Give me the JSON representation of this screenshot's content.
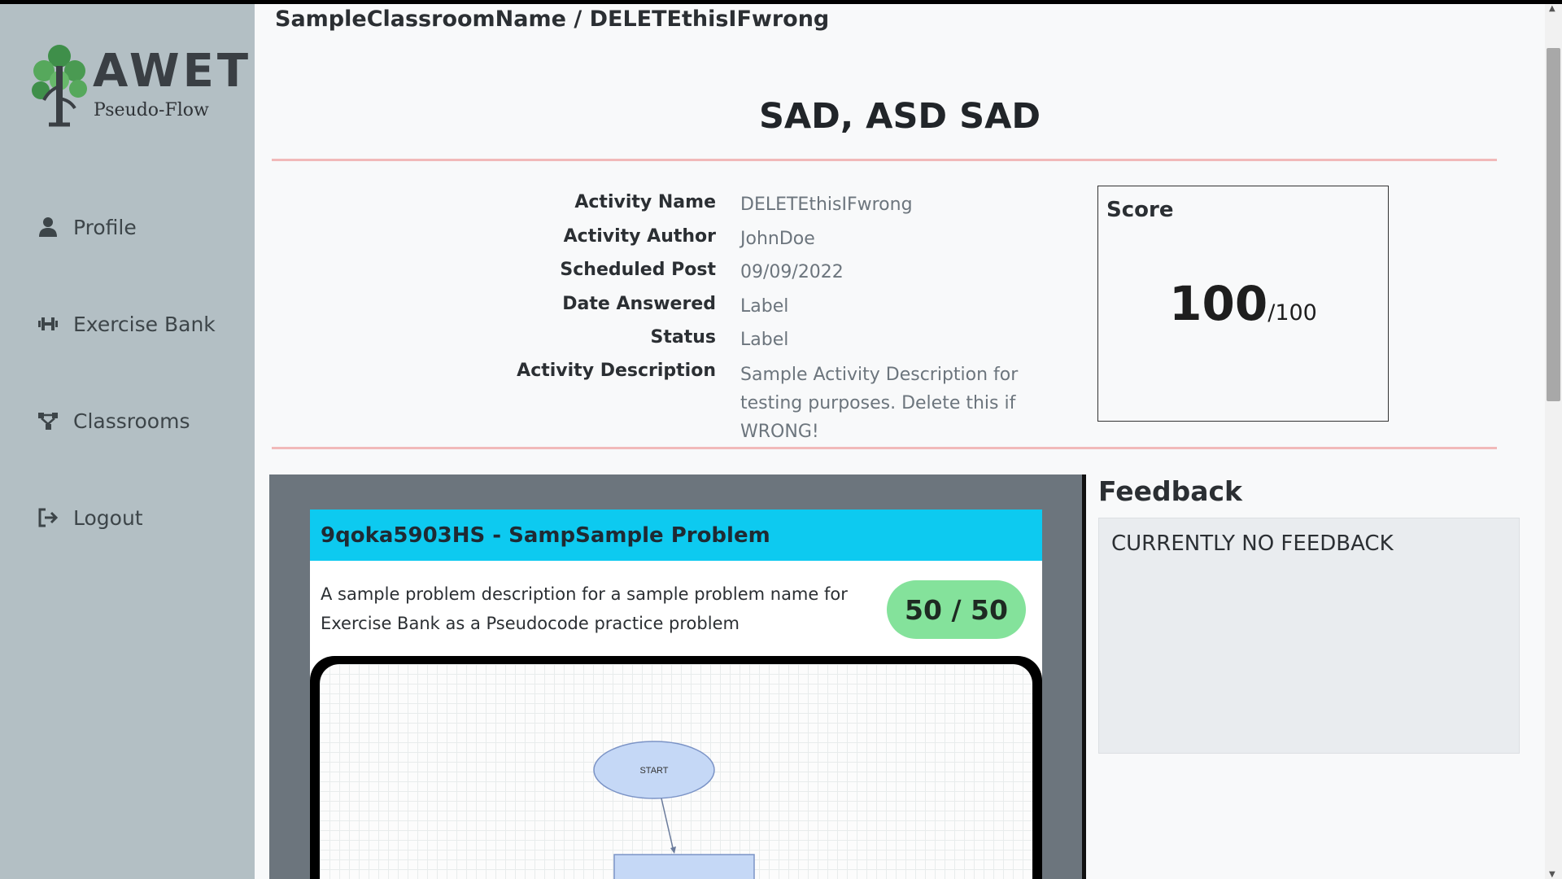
{
  "app": {
    "logo_word": "AWET",
    "logo_sub": "Pseudo-Flow"
  },
  "sidebar": {
    "items": [
      {
        "label": "Profile",
        "icon": "user-icon"
      },
      {
        "label": "Exercise Bank",
        "icon": "dumbbell-icon"
      },
      {
        "label": "Classrooms",
        "icon": "network-icon"
      },
      {
        "label": "Logout",
        "icon": "logout-icon"
      }
    ]
  },
  "header": {
    "breadcrumb": "SampleClassroomName / DELETEthisIFwrong",
    "title": "SAD, ASD SAD"
  },
  "activity": {
    "fields": [
      {
        "label": "Activity Name",
        "value": "DELETEthisIFwrong"
      },
      {
        "label": "Activity Author",
        "value": "JohnDoe"
      },
      {
        "label": "Scheduled Post",
        "value": "09/09/2022"
      },
      {
        "label": "Date Answered",
        "value": "Label"
      },
      {
        "label": "Status",
        "value": "Label"
      },
      {
        "label": "Activity Description",
        "value": "Sample Activity Description for testing purposes. Delete this if WRONG!"
      }
    ]
  },
  "score": {
    "title": "Score",
    "value": "100",
    "total": "/100"
  },
  "problem": {
    "header": "9qoka5903HS - SampSample Problem",
    "description": "A sample problem description for a sample problem name for Exercise Bank as a Pseudocode practice problem",
    "points": "50 / 50",
    "flowchart": {
      "start_label": "START"
    }
  },
  "feedback": {
    "title": "Feedback",
    "text": "CURRENTLY NO FEEDBACK"
  },
  "colors": {
    "sidebar": "#b3bfc4",
    "header_accent": "#0dcaf0",
    "points_pill": "#84e29b",
    "divider": "#f1b9b9"
  }
}
